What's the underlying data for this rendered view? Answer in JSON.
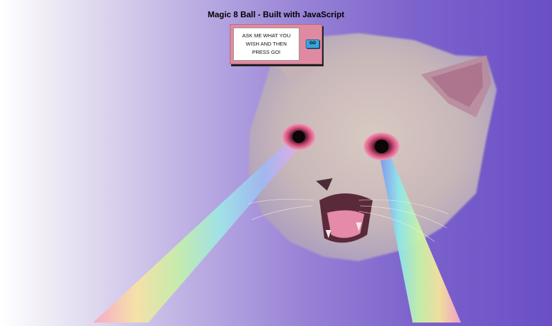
{
  "app": {
    "title": "Magic 8 Ball - Built with JavaScript"
  },
  "ask_panel": {
    "prompt_text": "ASK ME WHAT YOU WISH AND THEN PRESS GO!",
    "go_label": "GO"
  },
  "theme": {
    "background_left": "#ffffff",
    "background_right": "#6a4fc6",
    "panel_color": "#e08aa2",
    "button_color": "#3aa3dc"
  },
  "image": {
    "subject": "cat-with-rainbow-laser-eyes"
  }
}
